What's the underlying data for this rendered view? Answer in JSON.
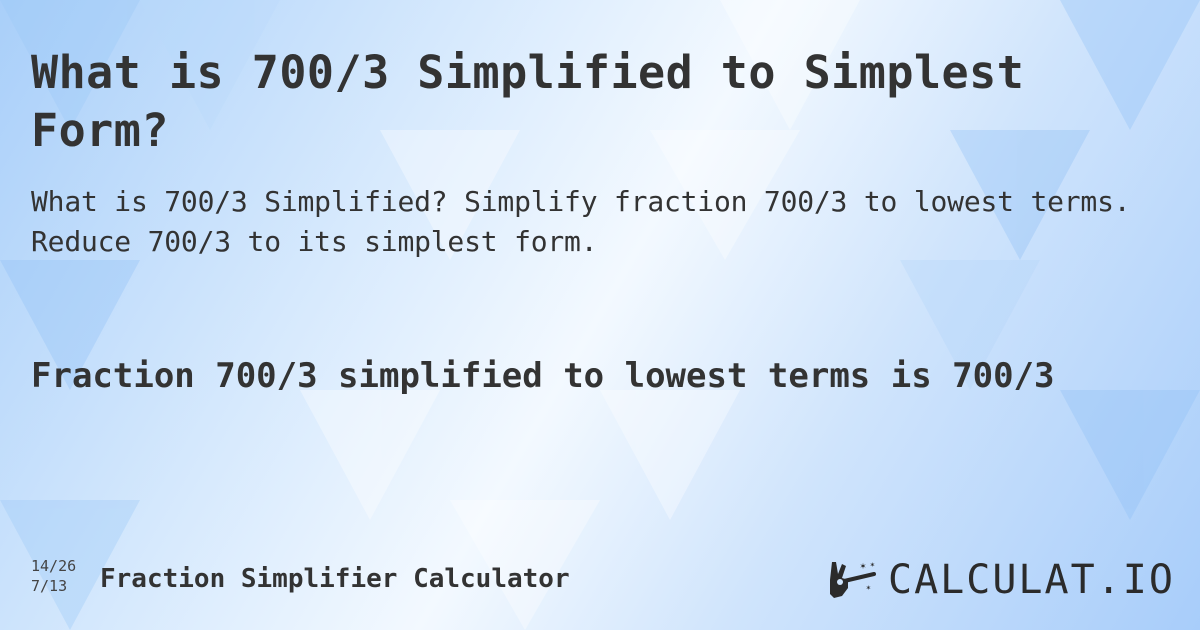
{
  "header": {
    "title": "What is 700/3 Simplified to Simplest Form?",
    "subtitle": "What is 700/3 Simplified? Simplify fraction 700/3 to lowest terms. Reduce 700/3 to its simplest form."
  },
  "result": {
    "text": "Fraction 700/3 simplified to lowest terms is 700/3"
  },
  "footer": {
    "icon_top": "14/26",
    "icon_bottom": "7/13",
    "calculator_name": "Fraction Simplifier Calculator",
    "logo_text": "CALCULAT.IO",
    "logo_icon": "magic-wand-hand-icon"
  },
  "colors": {
    "text": "#333333",
    "background_light": "#f3f9ff",
    "background_blue": "#a9cff9"
  }
}
